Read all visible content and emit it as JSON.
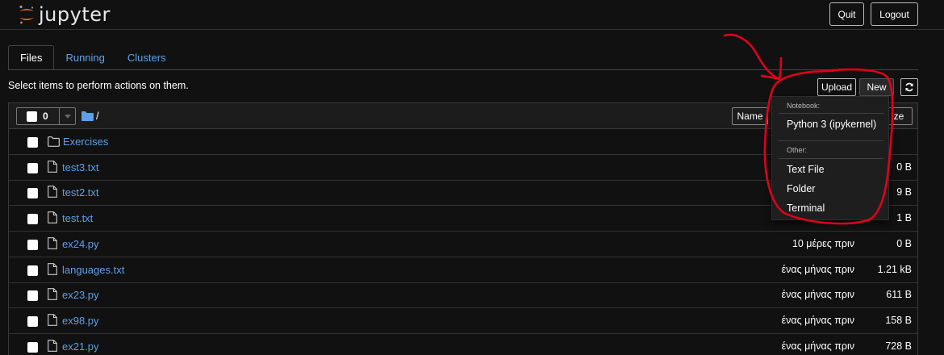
{
  "header": {
    "logo_text": "jupyter",
    "quit_label": "Quit",
    "logout_label": "Logout"
  },
  "tabs": [
    {
      "label": "Files",
      "active": true
    },
    {
      "label": "Running",
      "active": false
    },
    {
      "label": "Clusters",
      "active": false
    }
  ],
  "toolbar": {
    "instructions": "Select items to perform actions on them.",
    "upload_label": "Upload",
    "new_label": "New",
    "refresh_icon": "refresh-icon"
  },
  "list_header": {
    "selected_count": "0",
    "breadcrumb_sep": "/",
    "sort_name_label": "Name",
    "sort_size_label": "ze"
  },
  "files": [
    {
      "name": "Exercises",
      "type": "folder",
      "date": "",
      "size": ""
    },
    {
      "name": "test3.txt",
      "type": "file",
      "date": "",
      "size": "0 B"
    },
    {
      "name": "test2.txt",
      "type": "file",
      "date": "",
      "size": "9 B"
    },
    {
      "name": "test.txt",
      "type": "file",
      "date": "",
      "size": "1 B"
    },
    {
      "name": "ex24.py",
      "type": "file",
      "date": "10 μέρες πριν",
      "size": "0 B"
    },
    {
      "name": "languages.txt",
      "type": "file",
      "date": "ένας μήνας πριν",
      "size": "1.21 kB"
    },
    {
      "name": "ex23.py",
      "type": "file",
      "date": "ένας μήνας πριν",
      "size": "611 B"
    },
    {
      "name": "ex98.py",
      "type": "file",
      "date": "ένας μήνας πριν",
      "size": "158 B"
    },
    {
      "name": "ex21.py",
      "type": "file",
      "date": "ένας μήνας πριν",
      "size": "728 B"
    }
  ],
  "new_menu": {
    "notebook_header": "Notebook:",
    "python_label": "Python 3 (ipykernel)",
    "other_header": "Other:",
    "text_file_label": "Text File",
    "folder_label": "Folder",
    "terminal_label": "Terminal"
  },
  "colors": {
    "background": "#111111",
    "link": "#5ea1e6",
    "logo_orange": "#f37726",
    "annotation_red": "#e0001a"
  }
}
